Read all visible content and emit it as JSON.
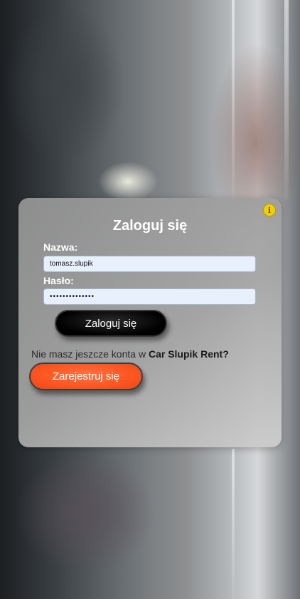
{
  "login_form": {
    "title": "Zaloguj się",
    "info_icon": "info-icon",
    "username_label": "Nazwa:",
    "username_value": "tomasz.slupik",
    "password_label": "Hasło:",
    "password_value": "••••••••••••••",
    "submit_label": "Zaloguj się"
  },
  "register": {
    "prompt": "Nie masz jeszcze konta w",
    "brand": "Car Slupik Rent?",
    "button_label": "Zarejestruj się"
  },
  "colors": {
    "info_icon": "#f2cf05",
    "login_button": "#000000",
    "register_button": "#ff5722",
    "input_background": "#e8f0fe"
  }
}
